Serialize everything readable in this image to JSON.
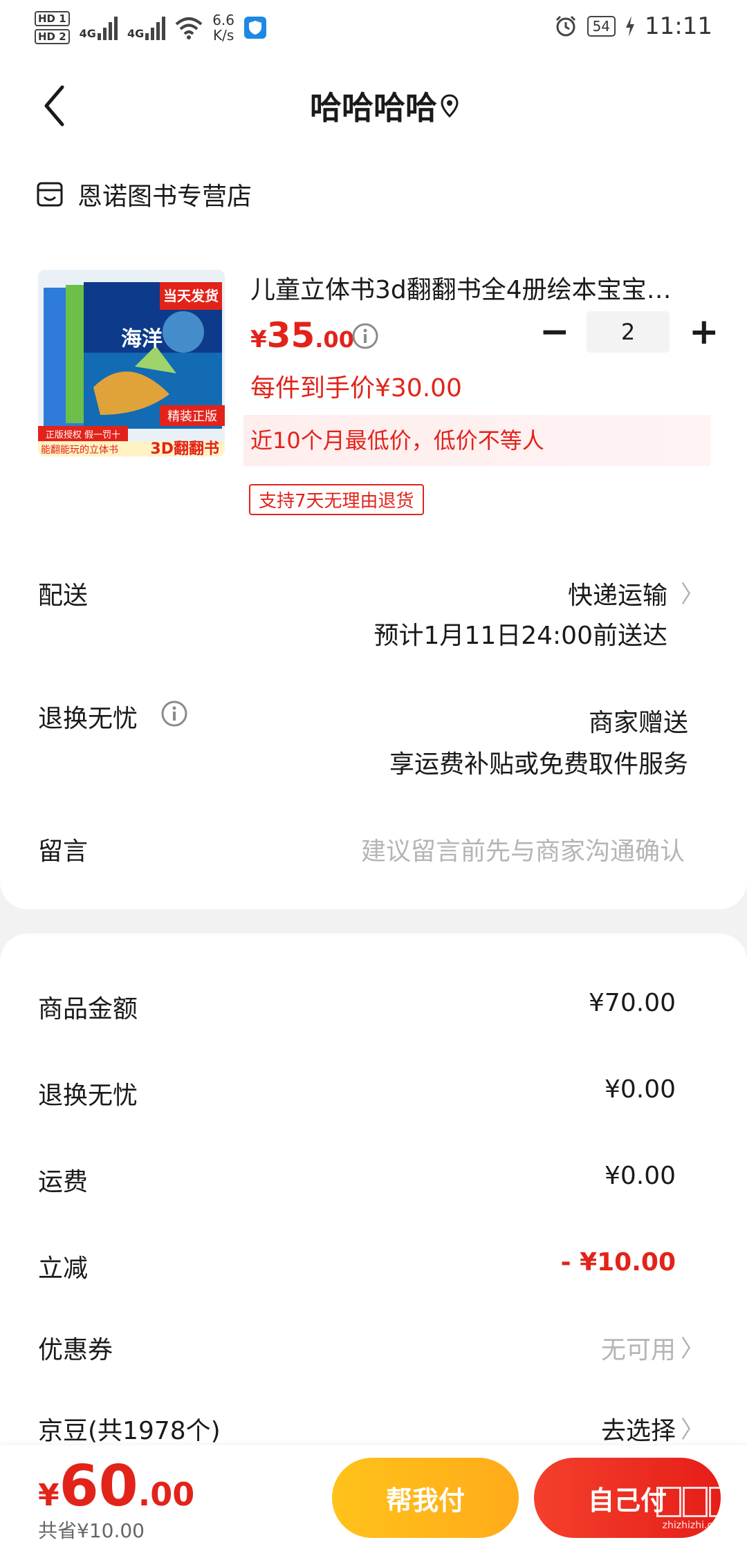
{
  "status_bar": {
    "hd1": "HD 1",
    "hd2": "HD 2",
    "net1": "4G",
    "net2": "4G",
    "speed": "6.6",
    "speed_unit": "K/s",
    "battery": "54",
    "time": "11:11"
  },
  "header": {
    "title": "哈哈哈哈"
  },
  "store": {
    "name": "恩诺图书专营店"
  },
  "product": {
    "name": "儿童立体书3d翻翻书全4册绘本宝宝…",
    "price_symbol": "¥",
    "price_int": "35",
    "price_dec": ".00",
    "quantity": "2",
    "minus": "−",
    "plus": "+",
    "unit_price_text": "每件到手价¥30.00",
    "lowest_text": "近10个月最低价，低价不等人",
    "return_badge": "支持7天无理由退货",
    "image_texts": {
      "same_day": "当天发货",
      "ocean": "海洋",
      "hardcover": "精装正版",
      "genuine": "正版授权 假一罚十",
      "tagline": "能翻能玩的立体书",
      "book3d": "3D翻翻书"
    }
  },
  "delivery": {
    "label": "配送",
    "method": "快递运输",
    "eta": "预计1月11日24:00前送达"
  },
  "worry_free": {
    "label": "退换无忧",
    "value": "商家赠送",
    "detail": "享运费补贴或免费取件服务"
  },
  "message": {
    "label": "留言",
    "placeholder": "建议留言前先与商家沟通确认"
  },
  "summary": {
    "goods_label": "商品金额",
    "goods_value": "¥70.00",
    "worry_label": "退换无忧",
    "worry_value": "¥0.00",
    "shipping_label": "运费",
    "shipping_value": "¥0.00",
    "discount_label": "立减",
    "discount_value": "- ¥10.00",
    "coupon_label": "优惠券",
    "coupon_value": "无可用",
    "beans_label": "京豆(共1978个)",
    "beans_value": "去选择"
  },
  "bottom": {
    "total_symbol": "¥",
    "total_int": "60",
    "total_dec": ".00",
    "saved": "共省¥10.00",
    "help_pay": "帮我付",
    "self_pay": "自己付"
  },
  "watermark": {
    "text": "zhizhizhi.com"
  },
  "colors": {
    "accent_red": "#e2231a",
    "help_yellow": "#ffb81a",
    "hint_gray": "#b5b5b5"
  }
}
